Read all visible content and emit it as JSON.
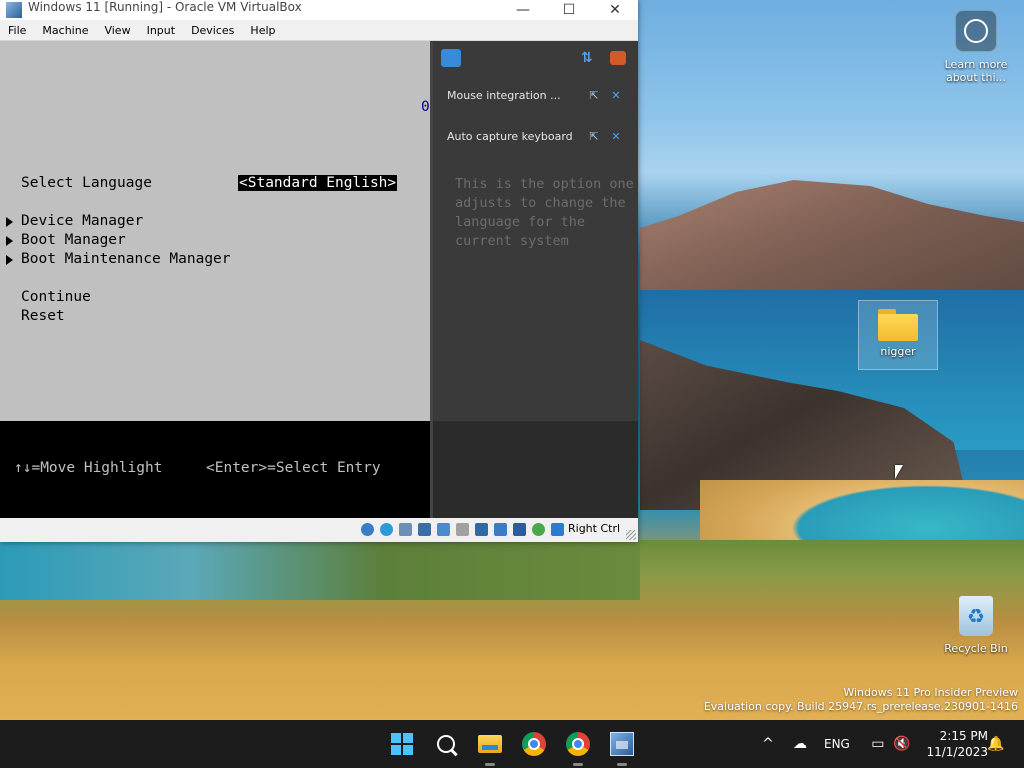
{
  "window": {
    "title": "Windows 11 [Running] - Oracle VM VirtualBox",
    "minimize": "—",
    "maximize": "☐",
    "close": "✕"
  },
  "menu": [
    "File",
    "Machine",
    "View",
    "Input",
    "Devices",
    "Help"
  ],
  "bios": {
    "select_language_label": "Select Language",
    "select_language_value": "<Standard English>",
    "menu_items": [
      "Device Manager",
      "Boot Manager",
      "Boot Maintenance Manager"
    ],
    "continue": "Continue",
    "reset": "Reset",
    "hint_move": "↑↓=Move Highlight",
    "hint_enter": "<Enter>=Select Entry",
    "help_text": "This is the option one adjusts to change the language for the current system",
    "stray_char": "0"
  },
  "notifications": [
    {
      "text": "Mouse integration ..."
    },
    {
      "text": "Auto capture keyboard ..."
    }
  ],
  "statusbar": {
    "host_key": "Right Ctrl",
    "icons": [
      "hard-disk-icon",
      "optical-drive-icon",
      "audio-icon",
      "network-icon",
      "usb-icon",
      "shared-folders-icon",
      "display-icon",
      "recording-icon",
      "vrde-icon",
      "cpu-icon",
      "mouse-icon",
      "keyboard-icon"
    ]
  },
  "desktop": {
    "learn_more": "Learn more about thi...",
    "folder_label": "nigger",
    "recycle_bin": "Recycle Bin",
    "watermark_line1": "Windows 11 Pro Insider Preview",
    "watermark_line2": "Evaluation copy. Build 25947.rs_prerelease.230901-1416"
  },
  "taskbar": {
    "language": "ENG",
    "time": "2:15 PM",
    "date": "11/1/2023"
  },
  "colors": {
    "bios_bg": "#c0c0c0",
    "side_panel": "#3a3a3a",
    "taskbar": "#1c1c1c",
    "accent": "#4cc2ff"
  }
}
